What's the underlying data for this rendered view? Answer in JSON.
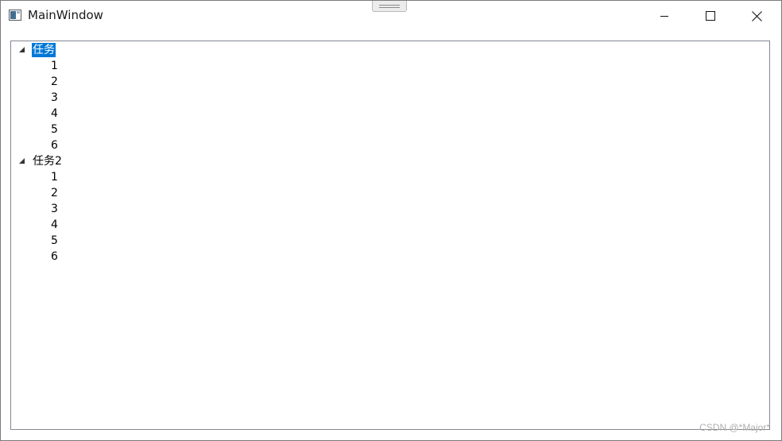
{
  "window": {
    "title": "MainWindow"
  },
  "tree": {
    "nodes": [
      {
        "label": "任务",
        "selected": true,
        "expanded": true,
        "children": [
          "1",
          "2",
          "3",
          "4",
          "5",
          "6"
        ]
      },
      {
        "label": "任务2",
        "selected": false,
        "expanded": true,
        "children": [
          "1",
          "2",
          "3",
          "4",
          "5",
          "6"
        ]
      }
    ]
  },
  "watermark": "CSDN @*Major*",
  "colors": {
    "selection": "#0078d7",
    "border": "#828790"
  },
  "icons": [
    "app-window-icon",
    "minimize-icon",
    "maximize-icon",
    "close-icon",
    "expander-triangle-icon"
  ]
}
